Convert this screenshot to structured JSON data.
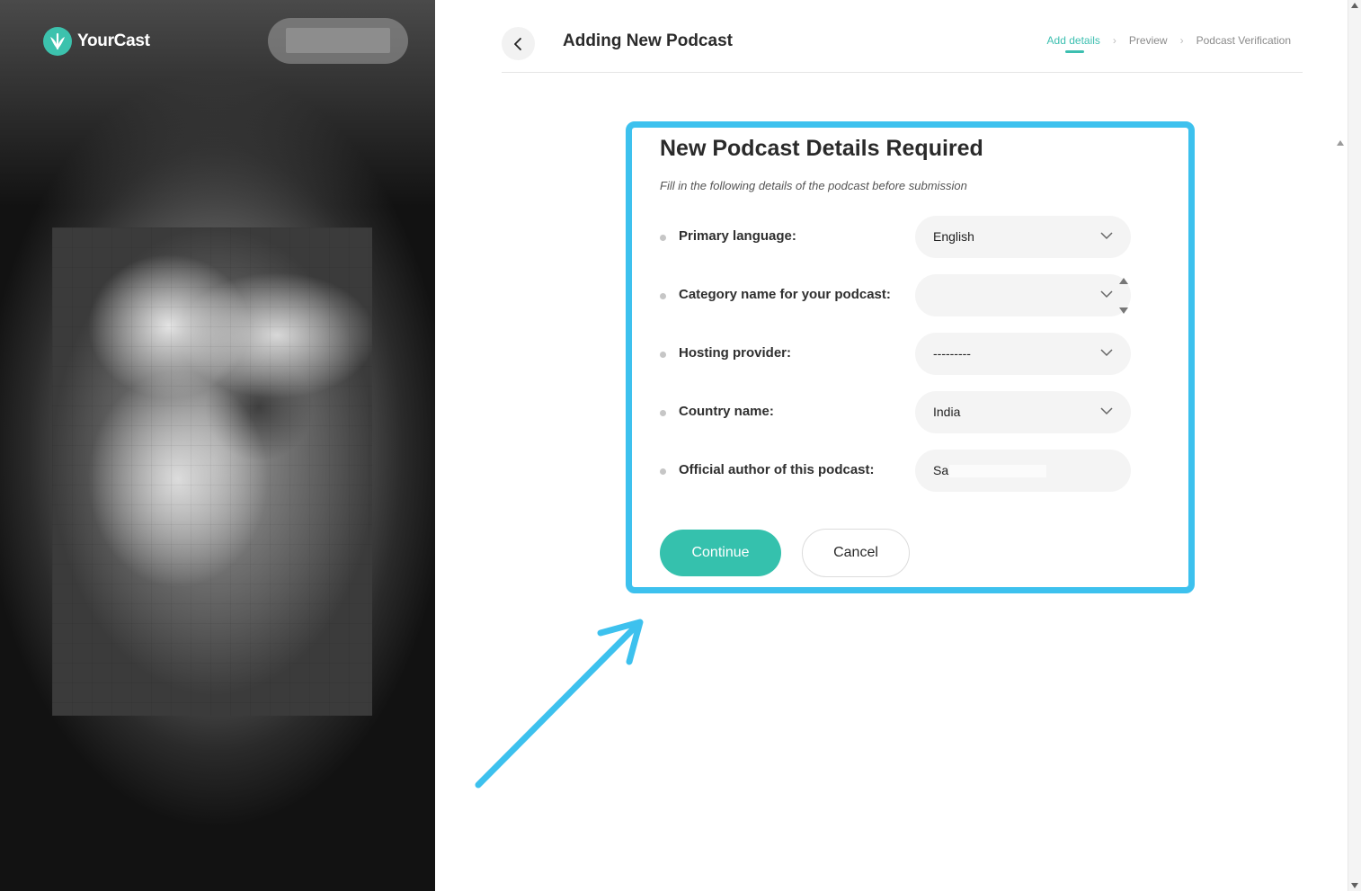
{
  "brand": {
    "name": "YourCast",
    "accent": "#35c1ad"
  },
  "header": {
    "title": "Adding New Podcast",
    "steps": [
      {
        "label": "Add details",
        "active": true
      },
      {
        "label": "Preview",
        "active": false
      },
      {
        "label": "Podcast Verification",
        "active": false
      }
    ]
  },
  "form": {
    "title": "New Podcast Details Required",
    "subtitle": "Fill in the following details of the podcast before submission",
    "fields": [
      {
        "label": "Primary language:",
        "value": "English",
        "type": "select"
      },
      {
        "label": "Category name for your podcast:",
        "value": "",
        "type": "select"
      },
      {
        "label": "Hosting provider:",
        "value": "---------",
        "type": "select"
      },
      {
        "label": "Country name:",
        "value": "India",
        "type": "select"
      },
      {
        "label": "Official author of this podcast:",
        "value": "Sa",
        "type": "text"
      }
    ],
    "continue_label": "Continue",
    "cancel_label": "Cancel"
  },
  "annotation": {
    "highlight_color": "#3dc1ee"
  }
}
